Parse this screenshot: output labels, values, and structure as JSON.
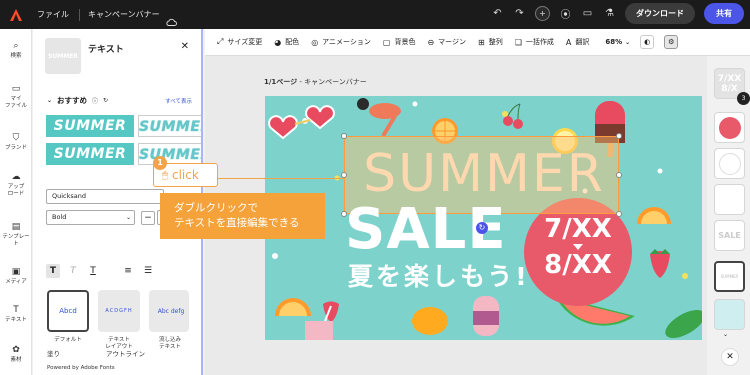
{
  "topbar": {
    "file_label": "ファイル",
    "doc_title": "キャンペーンバナー",
    "download_label": "ダウンロード",
    "share_label": "共有"
  },
  "leftrail": {
    "items": [
      {
        "label": "検索",
        "icon": "search-icon"
      },
      {
        "label": "マイ\nファイル",
        "icon": "folder-icon"
      },
      {
        "label": "ブランド",
        "icon": "brand-icon"
      },
      {
        "label": "アップ\nロード",
        "icon": "cloud-upload-icon"
      },
      {
        "label": "テンプレート",
        "icon": "template-icon"
      },
      {
        "label": "メディア",
        "icon": "media-icon"
      },
      {
        "label": "テキスト",
        "icon": "text-icon"
      },
      {
        "label": "素材",
        "icon": "elements-icon"
      }
    ]
  },
  "panel": {
    "thumb_text": "SUMMER",
    "title": "テキスト",
    "recommended_label": "おすすめ",
    "see_all_label": "すべて表示",
    "tiles": [
      "SUMMER",
      "SUMMER",
      "SUMMER",
      "SUMMER"
    ],
    "font_value": "Quicksand",
    "weight_value": "Bold",
    "layouts": [
      {
        "label": "デフォルト",
        "preview": "Abcd"
      },
      {
        "label": "テキスト\nレイアウト",
        "preview": "ACDGFH"
      },
      {
        "label": "流し込み\nテキスト",
        "preview": "Abc defg"
      }
    ],
    "fill_label": "塗り",
    "outline_label": "アウトライン",
    "powered_by": "Powered by Adobe Fonts"
  },
  "toolbar": {
    "items": [
      "サイズ変更",
      "配色",
      "アニメーション",
      "背景色",
      "マージン",
      "整列",
      "一括作成",
      "翻訳"
    ],
    "zoom": "68%"
  },
  "canvas": {
    "breadcrumb_page": "1/1ページ",
    "breadcrumb_name": "キャンペーンバナー",
    "headline": "SUMMER",
    "sale": "SALE",
    "tagline": "夏を楽しもう!",
    "date_start": "7/XX",
    "date_end": "8/XX",
    "click_num": "1",
    "click_text": "click",
    "callout_line1": "ダブルクリックで",
    "callout_line2": "テキストを直接編集できる"
  },
  "pages": {
    "thumb_first_text": "7/XX 8/X",
    "badge": "3",
    "thumb_texts": [
      "",
      "",
      "",
      "SALE",
      "SUMMER",
      ""
    ]
  },
  "colors": {
    "accent": "#4b55e8",
    "banner_bg": "#7dd3cc",
    "date_circle": "#e85a6a",
    "callout": "#f5a23a",
    "selection": "#ff9b3d"
  }
}
